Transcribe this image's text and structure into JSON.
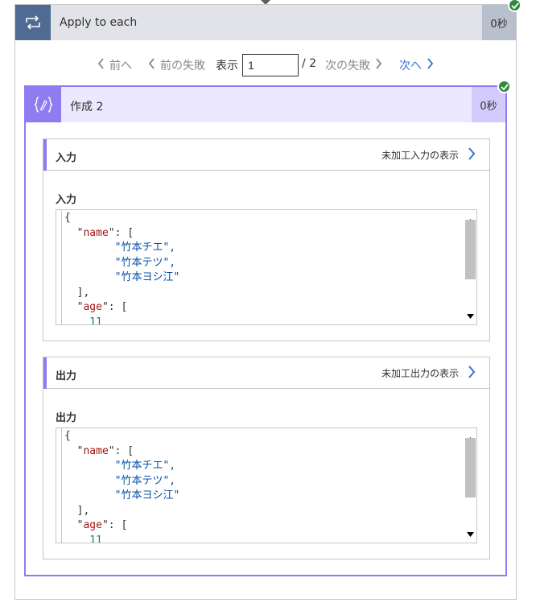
{
  "loop": {
    "title": "Apply to each",
    "duration": "0秒",
    "status_icon": "check-icon",
    "icon": "loop-icon"
  },
  "pager": {
    "prev_label": "前へ",
    "prev_fail_label": "前の失敗",
    "show_label": "表示",
    "page_value": "1",
    "total_label": "/ 2",
    "next_fail_label": "次の失敗",
    "next_label": "次へ"
  },
  "compose": {
    "title": "作成 2",
    "duration": "0秒",
    "status_icon": "check-icon",
    "icon": "compose-braces-icon"
  },
  "input_section": {
    "heading": "入力",
    "raw_link": "未加工入力の表示",
    "sub_label": "入力",
    "code_lines": [
      "{",
      "  \"name\": [",
      "    \"竹本チエ\",",
      "    \"竹本テツ\",",
      "    \"竹本ヨシ江\"",
      "  ],",
      "  \"age\": [",
      "    11"
    ]
  },
  "output_section": {
    "heading": "出力",
    "raw_link": "未加工出力の表示",
    "sub_label": "出力",
    "code_lines": [
      "{",
      "  \"name\": [",
      "    \"竹本チエ\",",
      "    \"竹本テツ\",",
      "    \"竹本ヨシ江\"",
      "  ],",
      "  \"age\": [",
      "    11"
    ]
  },
  "colors": {
    "loop_accent": "#4f6b93",
    "compose_accent": "#8e7cf0",
    "success": "#2f8a3d",
    "link": "#3a6fd8"
  }
}
